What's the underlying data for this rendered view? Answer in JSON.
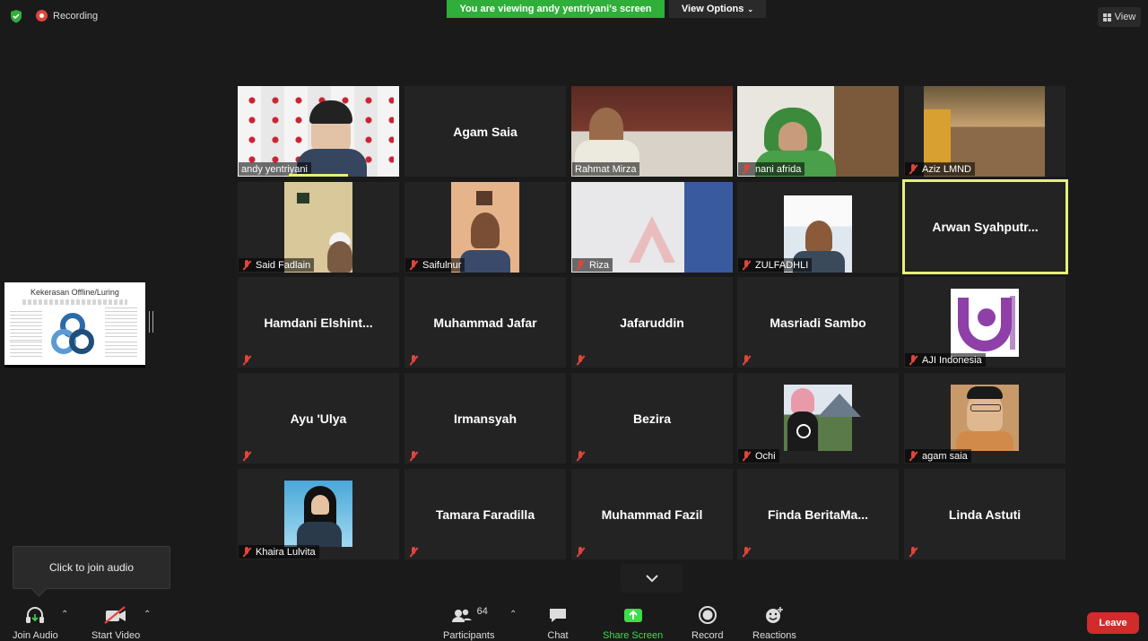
{
  "topbar": {
    "recording": "Recording",
    "viewing_banner": "You are viewing andy yentriyani's screen",
    "view_options": "View Options",
    "view": "View"
  },
  "shared_screen": {
    "title": "Kekerasan Offline/Luring"
  },
  "participants": [
    {
      "name": "andy yentriyani",
      "display": "video"
    },
    {
      "name": "Agam Saia",
      "display": "name"
    },
    {
      "name": "Rahmat Mirza",
      "display": "video"
    },
    {
      "name": "nani afrida",
      "display": "video",
      "muted": true
    },
    {
      "name": "Aziz LMND",
      "display": "video",
      "muted": true
    },
    {
      "name": "Said Fadlain",
      "display": "video",
      "muted": true
    },
    {
      "name": "Saifulnur",
      "display": "video",
      "muted": true
    },
    {
      "name": "Riza",
      "display": "video",
      "muted": true
    },
    {
      "name": "ZULFADHLI",
      "display": "video",
      "muted": true
    },
    {
      "name": "Arwan  Syahputr...",
      "display": "name",
      "active_speaker": true
    },
    {
      "name": "Hamdani  Elshint...",
      "display": "name",
      "muted": true
    },
    {
      "name": "Muhammad Jafar",
      "display": "name",
      "muted": true
    },
    {
      "name": "Jafaruddin",
      "display": "name",
      "muted": true
    },
    {
      "name": "Masriadi Sambo",
      "display": "name",
      "muted": true
    },
    {
      "name": "AJI Indonesia",
      "display": "logo",
      "muted": true
    },
    {
      "name": "Ayu 'Ulya",
      "display": "name",
      "muted": true
    },
    {
      "name": "Irmansyah",
      "display": "name",
      "muted": true
    },
    {
      "name": "Bezira",
      "display": "name",
      "muted": true
    },
    {
      "name": "Ochi",
      "display": "video",
      "muted": true
    },
    {
      "name": "agam saia",
      "display": "video",
      "muted": true
    },
    {
      "name": "Khaira Lulvita",
      "display": "video",
      "muted": true
    },
    {
      "name": "Tamara Faradilla",
      "display": "name",
      "muted": true
    },
    {
      "name": "Muhammad Fazil",
      "display": "name",
      "muted": true
    },
    {
      "name": "Finda  BeritaMa...",
      "display": "name",
      "muted": true
    },
    {
      "name": "Linda Astuti",
      "display": "name",
      "muted": true
    }
  ],
  "join_audio_tip": "Click to join audio",
  "toolbar": {
    "join_audio": "Join Audio",
    "start_video": "Start Video",
    "participants": "Participants",
    "participants_count": "64",
    "chat": "Chat",
    "share_screen": "Share Screen",
    "record": "Record",
    "reactions": "Reactions",
    "leave": "Leave"
  },
  "colors": {
    "viewing_banner": "#2fae3a",
    "active_speaker_border": "#e6f07a",
    "leave": "#d22b2b",
    "muted_icon": "#e0453b"
  }
}
